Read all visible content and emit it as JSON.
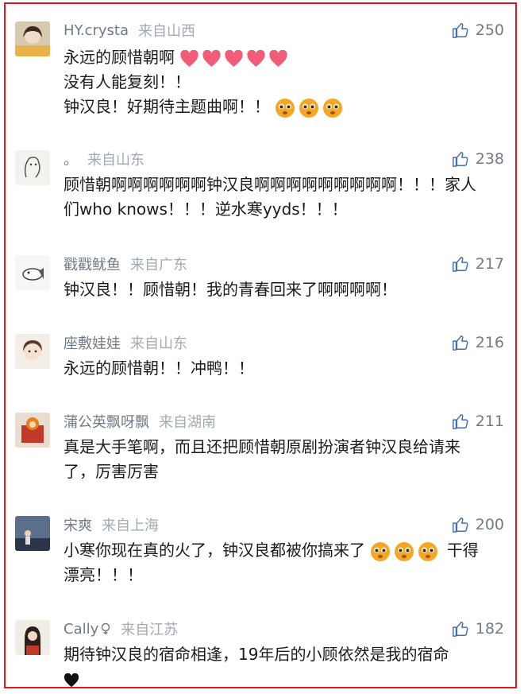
{
  "colors": {
    "border": "#e8141c",
    "username": "#727a87",
    "location": "#a3a9b3",
    "text": "#1b1b1b",
    "heart": "#f25c78",
    "emoji_face": "#f5a623"
  },
  "comments": [
    {
      "username": "HY.crysta",
      "location": "来自山西",
      "likes": "250",
      "lines": [
        "永远的顾惜朝啊",
        "没有人能复刻！！",
        "钟汉良！好期待主题曲啊！！"
      ],
      "emojis": [
        "heart",
        "heart",
        "heart",
        "heart",
        "heart",
        "face",
        "face",
        "face"
      ]
    },
    {
      "username": "。",
      "location": "来自山东",
      "likes": "238",
      "lines": [
        "顾惜朝啊啊啊啊啊啊钟汉良啊啊啊啊啊啊啊啊啊！！！家人",
        "们who knows！！！逆水寒yyds！！！"
      ]
    },
    {
      "username": "戳戳鱿鱼",
      "location": "来自广东",
      "likes": "217",
      "lines": [
        "钟汉良！！顾惜朝！我的青春回来了啊啊啊啊！"
      ]
    },
    {
      "username": "座敷娃娃",
      "location": "来自山东",
      "likes": "216",
      "lines": [
        "永远的顾惜朝！！冲鸭！！"
      ]
    },
    {
      "username": "蒲公英飘呀飘",
      "location": "来自湖南",
      "likes": "211",
      "lines": [
        "真是大手笔啊，而且还把顾惜朝原剧扮演者钟汉良给请来",
        "了，厉害厉害"
      ]
    },
    {
      "username": "宋爽",
      "location": "来自上海",
      "likes": "200",
      "lines": [
        "小寒你现在真的火了，钟汉良都被你搞来了",
        "干得",
        "漂亮！！！"
      ],
      "emojis": [
        "face",
        "face",
        "face"
      ]
    },
    {
      "username": "Cally",
      "location": "来自江苏",
      "likes": "182",
      "lines": [
        "期待钟汉良的宿命相逢，19年后的小顾依然是我的宿命"
      ],
      "emojis": [
        "black-heart"
      ]
    }
  ]
}
